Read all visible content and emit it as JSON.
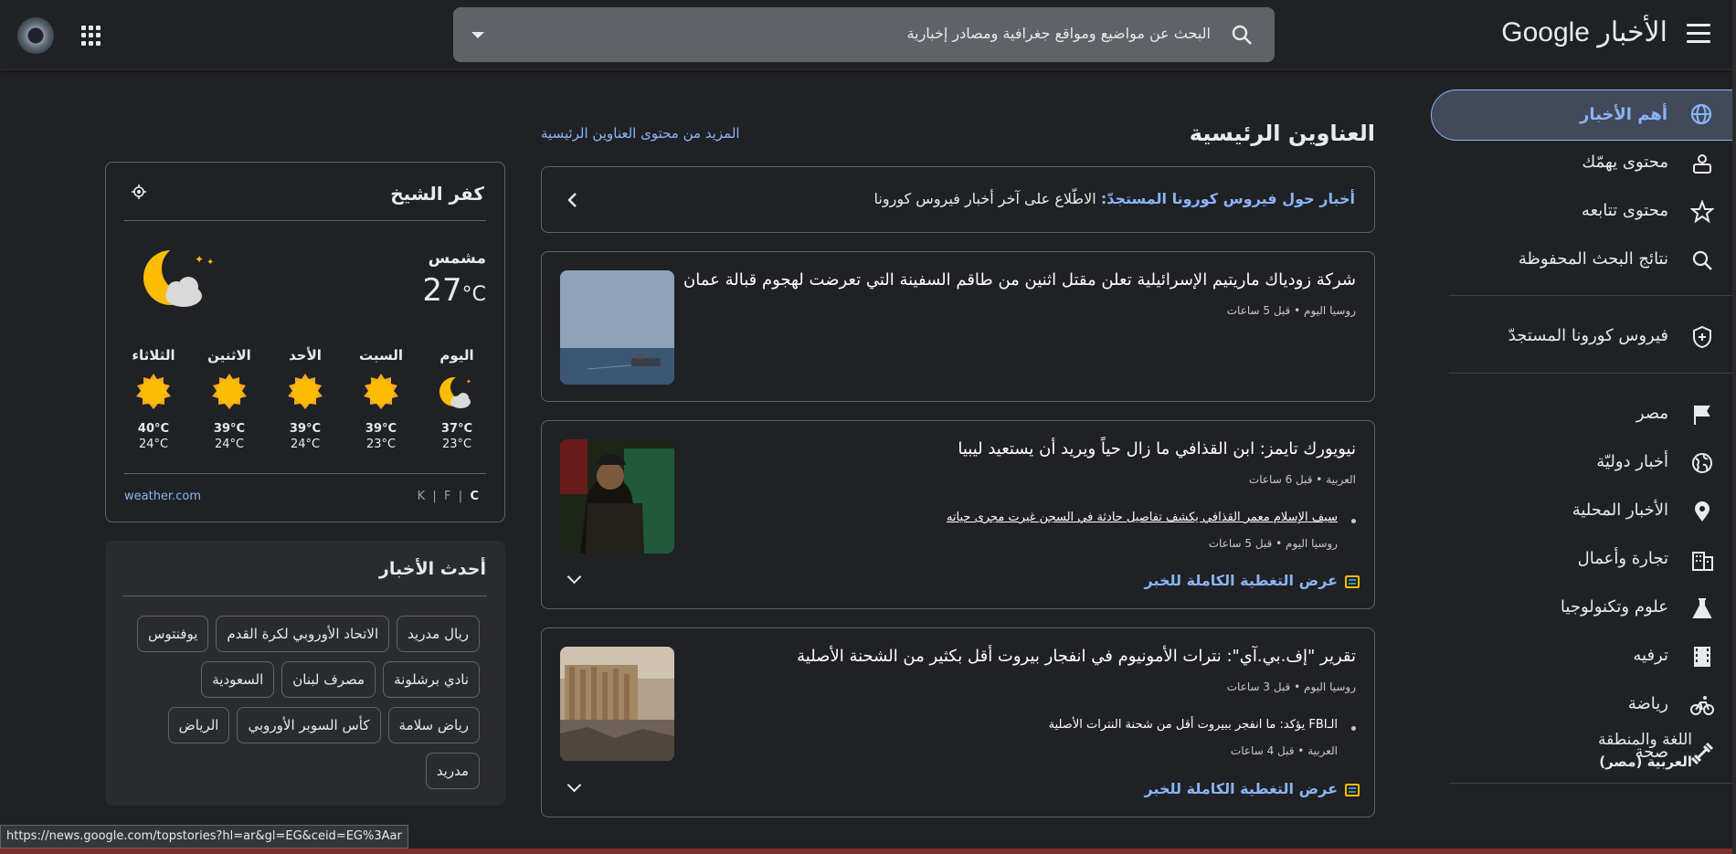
{
  "header": {
    "logo": "Google الأخبار",
    "search_placeholder": "البحث عن مواضيع ومواقع جغرافية ومصادر إخبارية"
  },
  "sidebar": {
    "items": [
      {
        "label": "أهم الأخبار",
        "icon": "globe-icon",
        "active": true
      },
      {
        "label": "محتوى يهمّك",
        "icon": "person-icon"
      },
      {
        "label": "محتوى تتابعه",
        "icon": "star-icon"
      },
      {
        "label": "نتائج البحث المحفوظة",
        "icon": "search-icon"
      },
      {
        "label": "فيروس كورونا المستجدّ",
        "icon": "shield-icon"
      },
      {
        "label": "مصر",
        "icon": "flag-icon"
      },
      {
        "label": "أخبار دوليّة",
        "icon": "world-icon"
      },
      {
        "label": "الأخبار المحلية",
        "icon": "pin-icon"
      },
      {
        "label": "تجارة وأعمال",
        "icon": "building-icon"
      },
      {
        "label": "علوم وتكنولوجيا",
        "icon": "flask-icon"
      },
      {
        "label": "ترفيه",
        "icon": "film-icon"
      },
      {
        "label": "رياضة",
        "icon": "bike-icon"
      },
      {
        "label": "صحة",
        "icon": "dumbbell-icon"
      }
    ],
    "language_title": "اللغة والمنطقة",
    "language_value": "العربية (مصر)"
  },
  "main": {
    "title": "العناوين الرئيسية",
    "more_link": "المزيد من محتوى العناوين الرئيسية",
    "covid_bold": "أخبار حول فيروس كورونا المستجدّ:",
    "covid_text": "الاطّلاع على آخر أخبار فيروس كورونا",
    "coverage_label": "عرض التغطية الكاملة للخبر",
    "stories": [
      {
        "headline": "شركة زودياك ماريتيم الإسرائيلية تعلن مقتل اثنين من طاقم السفينة التي تعرضت لهجوم قبالة عمان",
        "source": "روسيا اليوم",
        "time": "قبل 5 ساعات"
      },
      {
        "headline": "نيويورك تايمز: ابن القذافي ما زال حياً ويريد أن يستعيد ليبيا",
        "source": "العربية",
        "time": "قبل 6 ساعات",
        "sub_headline": "سيف الإسلام معمر القذافي يكشف تفاصيل حادثة في السجن غيرت مجرى حياته",
        "sub_source": "روسيا اليوم",
        "sub_time": "قبل 5 ساعات"
      },
      {
        "headline": "تقرير \"إف.بي.آي\": نترات الأمونيوم في انفجار بيروت أقل بكثير من الشحنة الأصلية",
        "source": "روسيا اليوم",
        "time": "قبل 3 ساعات",
        "sub_headline": "الـFBI يؤكد: ما انفجر ببيروت أقل من شحنة النترات الأصلية",
        "sub_source": "العربية",
        "sub_time": "قبل 4 ساعات"
      }
    ]
  },
  "weather": {
    "city": "كفر الشيخ",
    "condition": "مشمس",
    "temp": "27",
    "unit": "°C",
    "days": [
      {
        "day": "اليوم",
        "hi": "37°C",
        "lo": "23°C",
        "icon": "moon-cloud-icon"
      },
      {
        "day": "السبت",
        "hi": "39°C",
        "lo": "23°C",
        "icon": "sun-icon"
      },
      {
        "day": "الأحد",
        "hi": "39°C",
        "lo": "24°C",
        "icon": "sun-icon"
      },
      {
        "day": "الاثنين",
        "hi": "39°C",
        "lo": "24°C",
        "icon": "sun-icon"
      },
      {
        "day": "الثلاثاء",
        "hi": "40°C",
        "lo": "24°C",
        "icon": "sun-icon"
      }
    ],
    "source": "weather.com",
    "unit_c": "C",
    "unit_f": "F",
    "unit_k": "K",
    "separator": "|"
  },
  "latest": {
    "title": "أحدث الأخبار",
    "chips": [
      "ريال مدريد",
      "الاتحاد الأوروبي لكرة القدم",
      "يوفنتوس",
      "نادي برشلونة",
      "مصرف لبنان",
      "السعودية",
      "رياض سلامة",
      "كأس السوبر الأوروبي",
      "الرياض",
      "مدريد"
    ]
  },
  "status_url": "https://news.google.com/topstories?hl=ar&gl=EG&ceid=EG%3Aar",
  "colors": {
    "background": "#202124",
    "accent": "#8ab4f8",
    "active_bg": "#41495a"
  }
}
